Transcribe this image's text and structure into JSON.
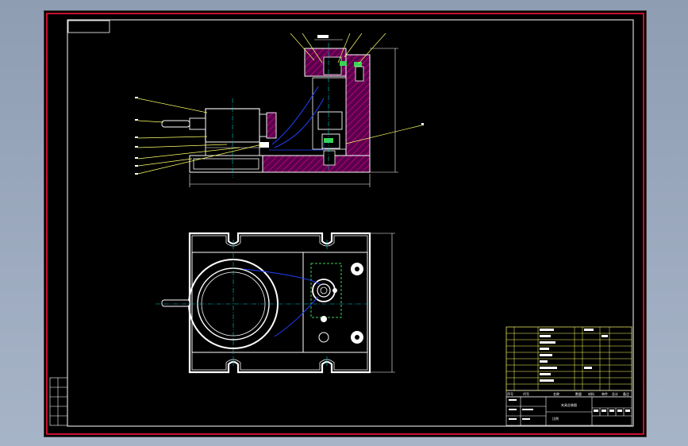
{
  "drawing": {
    "title_block": {
      "drawing_name": "夹具总装图",
      "scale_label": "比例",
      "header_cells": [
        "序号",
        "代号",
        "名称",
        "数量",
        "材料",
        "单件",
        "总计",
        "备注"
      ]
    },
    "colors": {
      "frame_red": "#c8102e",
      "outline_white": "#ffffff",
      "hatch_magenta": "#b0007a",
      "leader_yellow": "#ffff66",
      "center_blue": "#2040ff",
      "accent_green": "#39d353",
      "accent_cyan": "#00c8c8"
    }
  }
}
